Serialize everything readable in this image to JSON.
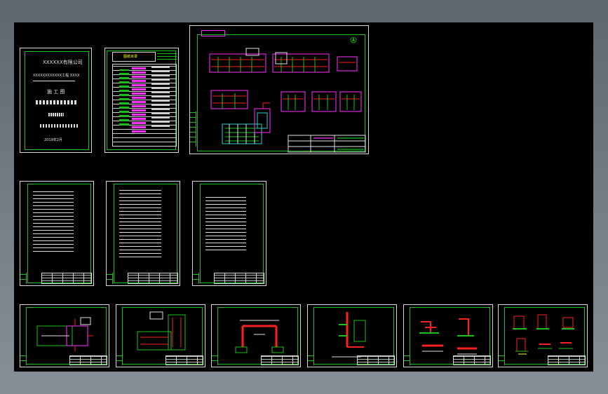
{
  "colors": {
    "background": "#000000",
    "frame": "#18c218",
    "magenta": "#ff33ff",
    "red": "#ff2020",
    "cyan": "#33cccc",
    "yellow": "#ffff33",
    "white": "#e0e0e0"
  },
  "cover_sheet": {
    "company": "XXXXXX有限公司",
    "project": "XXXXXXXXXXXX工程 XXXX",
    "stage": "施 工 图",
    "date": "2019年2月"
  },
  "drawing_list": {
    "title": "图纸目录"
  }
}
